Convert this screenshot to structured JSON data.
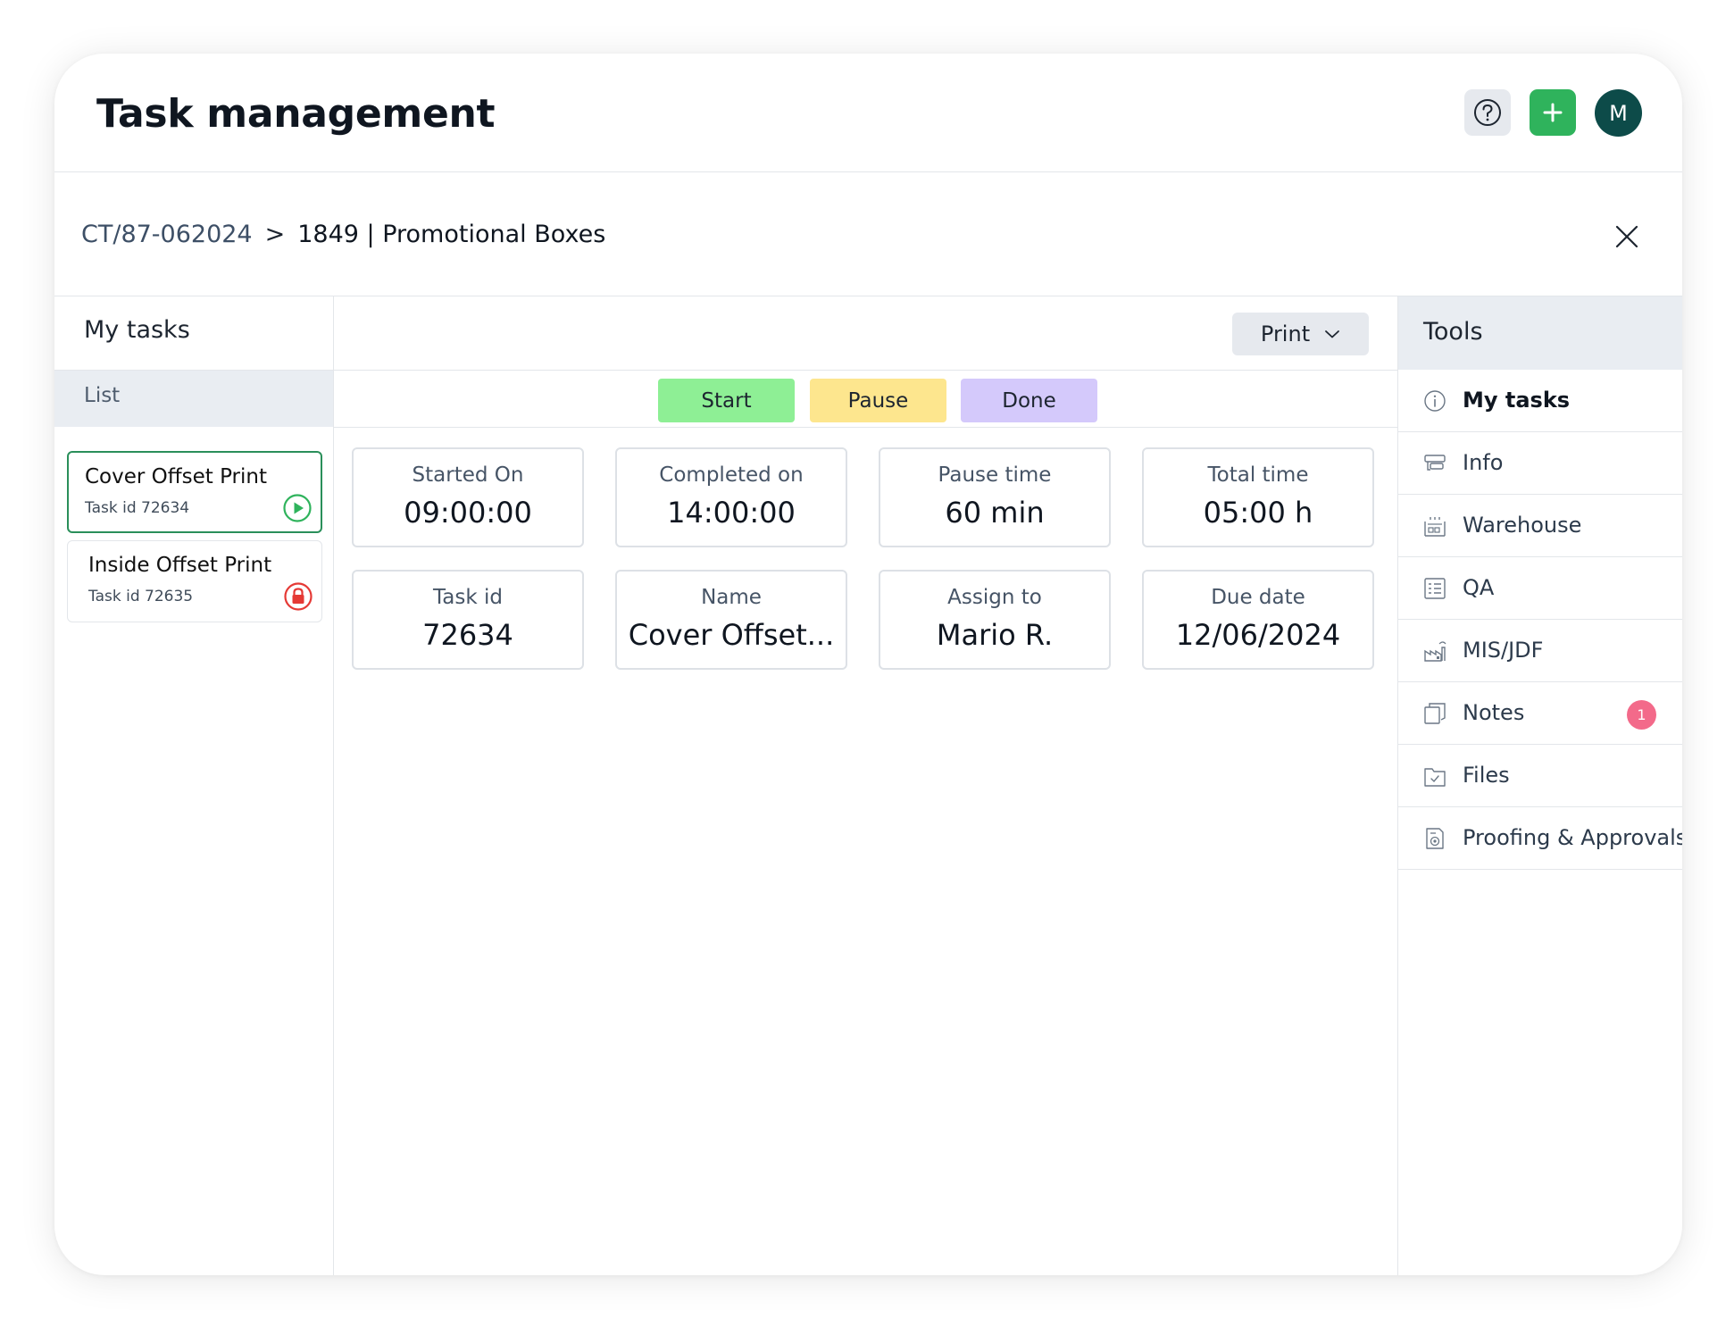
{
  "header": {
    "title": "Task management",
    "avatar_initial": "M"
  },
  "breadcrumb": {
    "parent": "CT/87-062024",
    "separator": ">",
    "current": "1849 | Promotional Boxes"
  },
  "left": {
    "title": "My tasks",
    "list_label": "List",
    "tasks": [
      {
        "name": "Cover Offset Print",
        "id": "Task id 72634",
        "status": "play-icon"
      },
      {
        "name": "Inside Offset Print",
        "id": "Task id 72635",
        "status": "lock-icon"
      }
    ]
  },
  "print_button": {
    "label": "Print"
  },
  "actions": {
    "start": "Start",
    "pause": "Pause",
    "done": "Done"
  },
  "cards": [
    {
      "label": "Started On",
      "value": "09:00:00"
    },
    {
      "label": "Completed on",
      "value": "14:00:00"
    },
    {
      "label": "Pause time",
      "value": "60 min"
    },
    {
      "label": "Total time",
      "value": "05:00 h"
    },
    {
      "label": "Task id",
      "value": "72634"
    },
    {
      "label": "Name",
      "value": "Cover Offset..."
    },
    {
      "label": "Assign to",
      "value": "Mario R."
    },
    {
      "label": "Due date",
      "value": "12/06/2024"
    }
  ],
  "tools": {
    "title": "Tools",
    "items": [
      {
        "label": "My tasks",
        "icon": "info-circle-icon"
      },
      {
        "label": "Info",
        "icon": "info-card-icon"
      },
      {
        "label": "Warehouse",
        "icon": "warehouse-icon"
      },
      {
        "label": "QA",
        "icon": "checklist-icon"
      },
      {
        "label": "MIS/JDF",
        "icon": "factory-icon"
      },
      {
        "label": "Notes",
        "icon": "notes-icon",
        "badge": "1"
      },
      {
        "label": "Files",
        "icon": "folder-check-icon"
      },
      {
        "label": "Proofing & Approvals",
        "icon": "proofing-icon"
      }
    ]
  },
  "colors": {
    "accent_green": "#2fb35c",
    "avatar_bg": "#0d4b49",
    "start": "#8eef95",
    "pause": "#fde68e",
    "done": "#d4c9fb",
    "badge": "#f36a8a"
  }
}
